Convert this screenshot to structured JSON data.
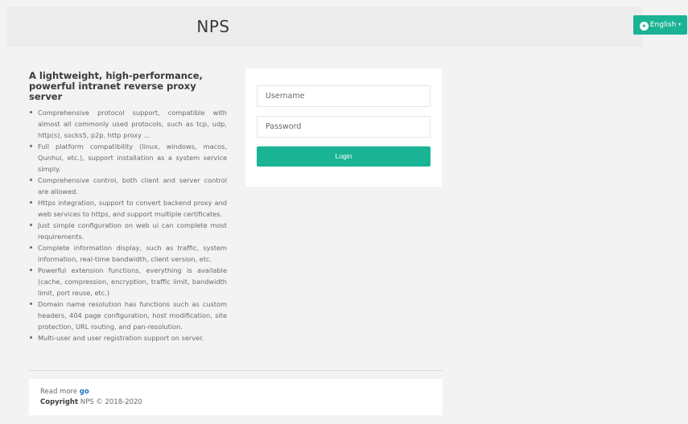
{
  "header": {
    "title": "NPS",
    "language_button": {
      "label": "English",
      "icon": "globe-icon",
      "caret": "▾"
    }
  },
  "intro": {
    "heading": "A lightweight, high-performance, powerful intranet reverse proxy server",
    "features": [
      "Comprehensive protocol support, compatible with almost all commonly used protocols, such as tcp, udp, http(s), socks5, p2p, http proxy ...",
      "Full platform compatibility (linux, windows, macos, Qunhui, etc.), support installation as a system service simply.",
      "Comprehensive control, both client and server control are allowed.",
      "Https integration, support to convert backend proxy and web services to https, and support multiple certificates.",
      "Just simple configuration on web ui can complete most requirements.",
      "Complete information display, such as traffic, system information, real-time bandwidth, client version, etc.",
      "Powerful extension functions, everything is available (cache, compression, encryption, traffic limit, bandwidth limit, port reuse, etc.)",
      "Domain name resolution has functions such as custom headers, 404 page configuration, host modification, site protection, URL routing, and pan-resolution.",
      "Multi-user and user registration support on server."
    ]
  },
  "login": {
    "username_placeholder": "Username",
    "password_placeholder": "Password",
    "button_label": "Login"
  },
  "footer": {
    "read_more_label": "Read more",
    "read_more_link": "go",
    "copyright_label": "Copyright",
    "copyright_text": "NPS © 2018-2020"
  },
  "colors": {
    "accent": "#1ab394",
    "background": "#f3f3f4",
    "link": "#1a73c8"
  }
}
